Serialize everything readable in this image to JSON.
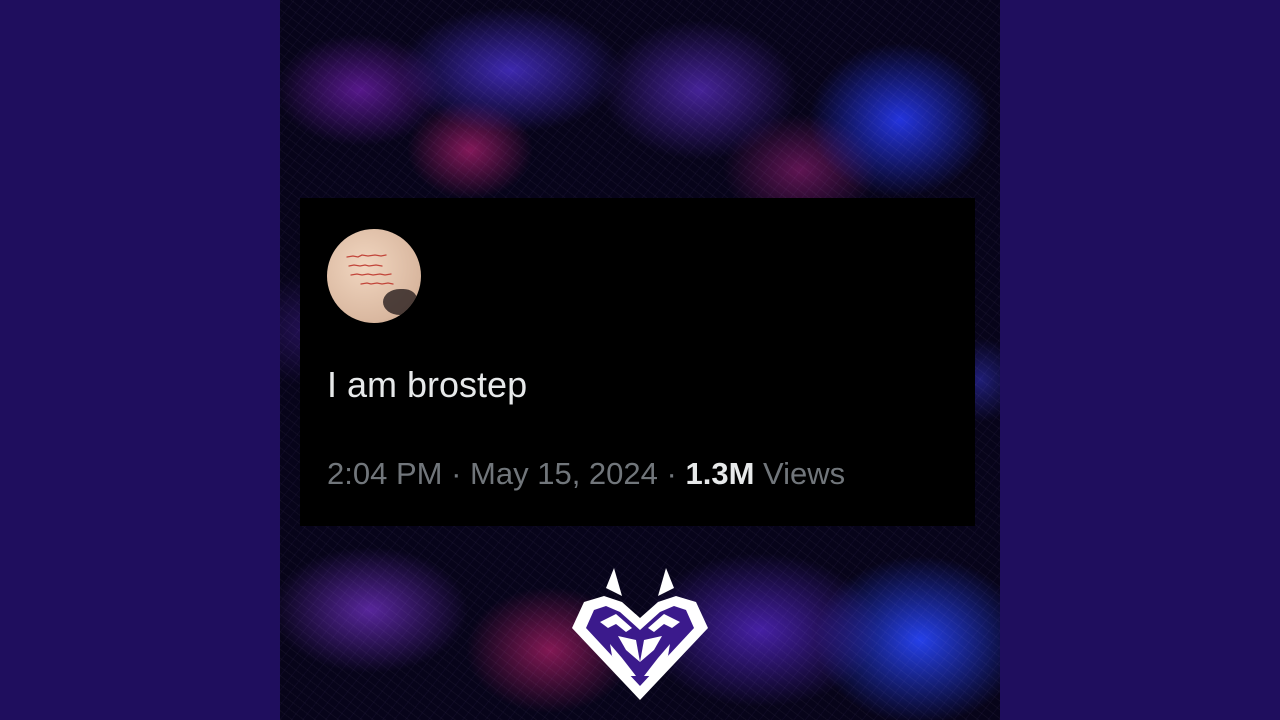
{
  "tweet": {
    "text": "I am brostep",
    "time": "2:04 PM",
    "separator": "·",
    "date": "May 15, 2024",
    "views_count": "1.3M",
    "views_label": "Views"
  },
  "colors": {
    "side_background": "#1f0e5e",
    "card_background": "#000000",
    "primary_text": "#e7e9ea",
    "secondary_text": "#71767b"
  },
  "icons": {
    "logo": "wolf-heart-logo-icon"
  }
}
